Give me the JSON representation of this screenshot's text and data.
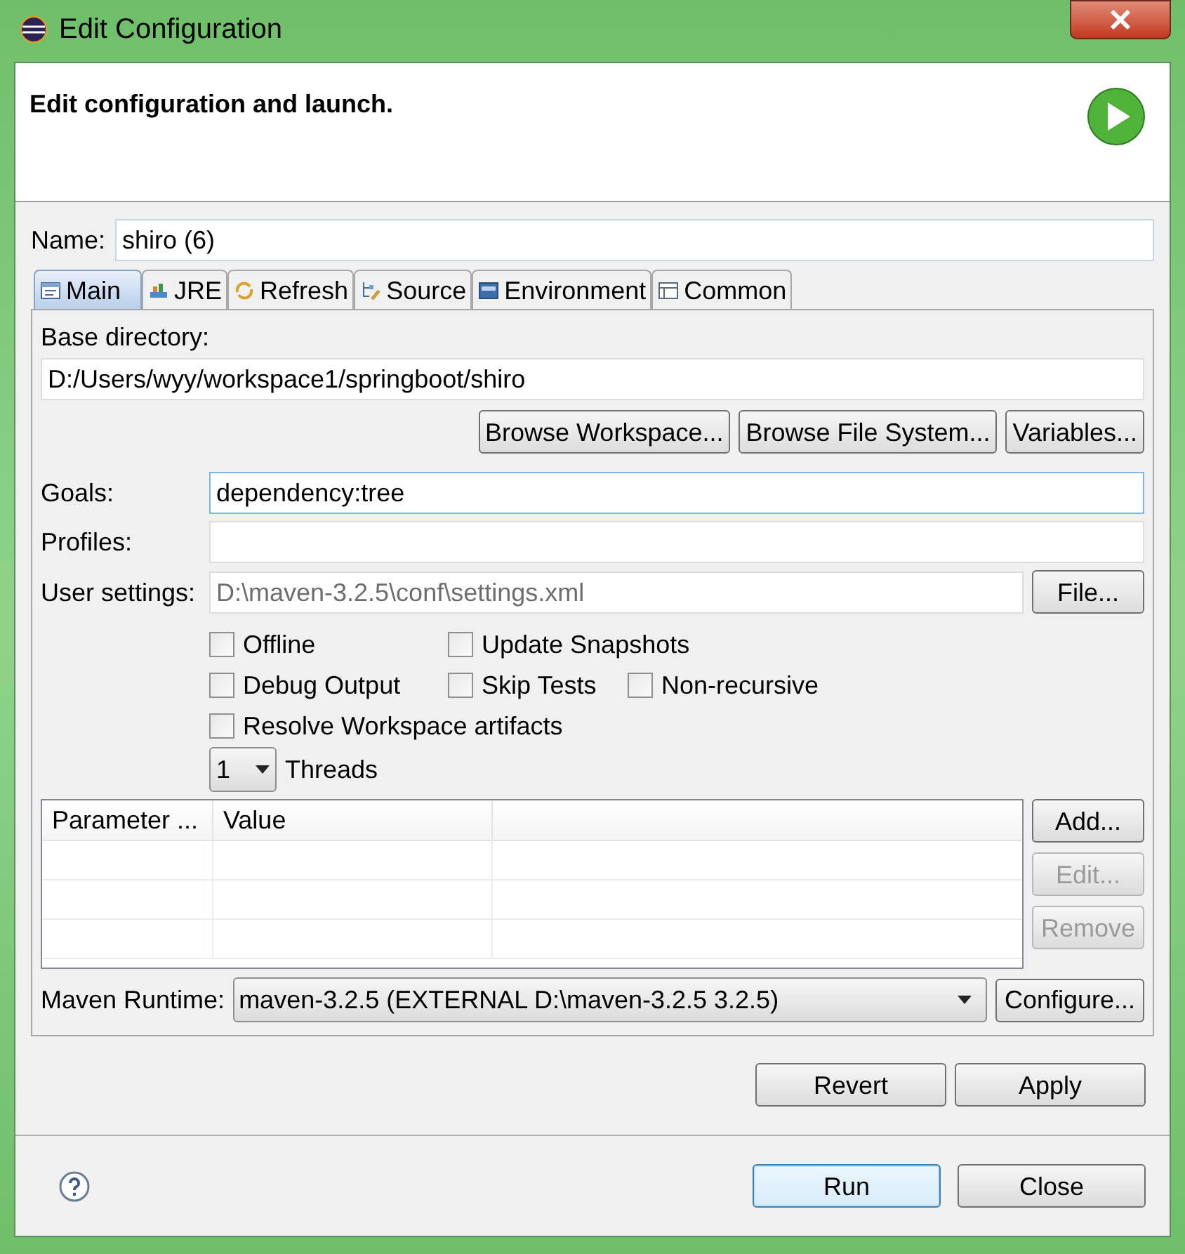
{
  "window": {
    "title": "Edit Configuration"
  },
  "header": {
    "message": "Edit configuration and launch."
  },
  "name_field": {
    "label": "Name:",
    "value": "shiro (6)"
  },
  "tabs": [
    {
      "label": "Main",
      "selected": true
    },
    {
      "label": "JRE",
      "selected": false
    },
    {
      "label": "Refresh",
      "selected": false
    },
    {
      "label": "Source",
      "selected": false
    },
    {
      "label": "Environment",
      "selected": false
    },
    {
      "label": "Common",
      "selected": false
    }
  ],
  "base_directory": {
    "label": "Base directory:",
    "value": "D:/Users/wyy/workspace1/springboot/shiro",
    "buttons": [
      {
        "label": "Browse Workspace...",
        "disabled": false
      },
      {
        "label": "Browse File System...",
        "disabled": false
      },
      {
        "label": "Variables...",
        "disabled": false
      }
    ]
  },
  "fields": [
    {
      "label": "Goals:",
      "value": "dependency:tree",
      "focused": true
    },
    {
      "label": "Profiles:",
      "focused": false
    },
    {
      "label": "User settings:",
      "value": "D:\\maven-3.2.5\\conf\\settings.xml",
      "focused": false,
      "button": "File..."
    }
  ],
  "options": [
    [
      {
        "label": "Offline",
        "checked": false
      },
      {
        "label": "Update Snapshots",
        "checked": false
      }
    ],
    [
      {
        "label": "Debug Output",
        "checked": false
      },
      {
        "label": "Skip Tests",
        "checked": false
      },
      {
        "label": "Non-recursive",
        "checked": false
      }
    ],
    [
      {
        "label": "Resolve Workspace artifacts",
        "checked": false
      }
    ]
  ],
  "threads": {
    "value": "1",
    "label": "Threads"
  },
  "parameters": {
    "columns": [
      "Parameter ...",
      "Value"
    ],
    "buttons": [
      {
        "label": "Add...",
        "disabled": false
      },
      {
        "label": "Edit...",
        "disabled": true
      },
      {
        "label": "Remove",
        "disabled": true
      }
    ]
  },
  "maven_runtime": {
    "label": "Maven Runtime:",
    "value": "maven-3.2.5 (EXTERNAL D:\\maven-3.2.5 3.2.5)",
    "button": "Configure..."
  },
  "panel_buttons": [
    {
      "label": "Revert",
      "default": false
    },
    {
      "label": "Apply",
      "default": false
    }
  ],
  "dialog_buttons": [
    {
      "label": "Run",
      "default": true
    },
    {
      "label": "Close",
      "default": false
    }
  ]
}
